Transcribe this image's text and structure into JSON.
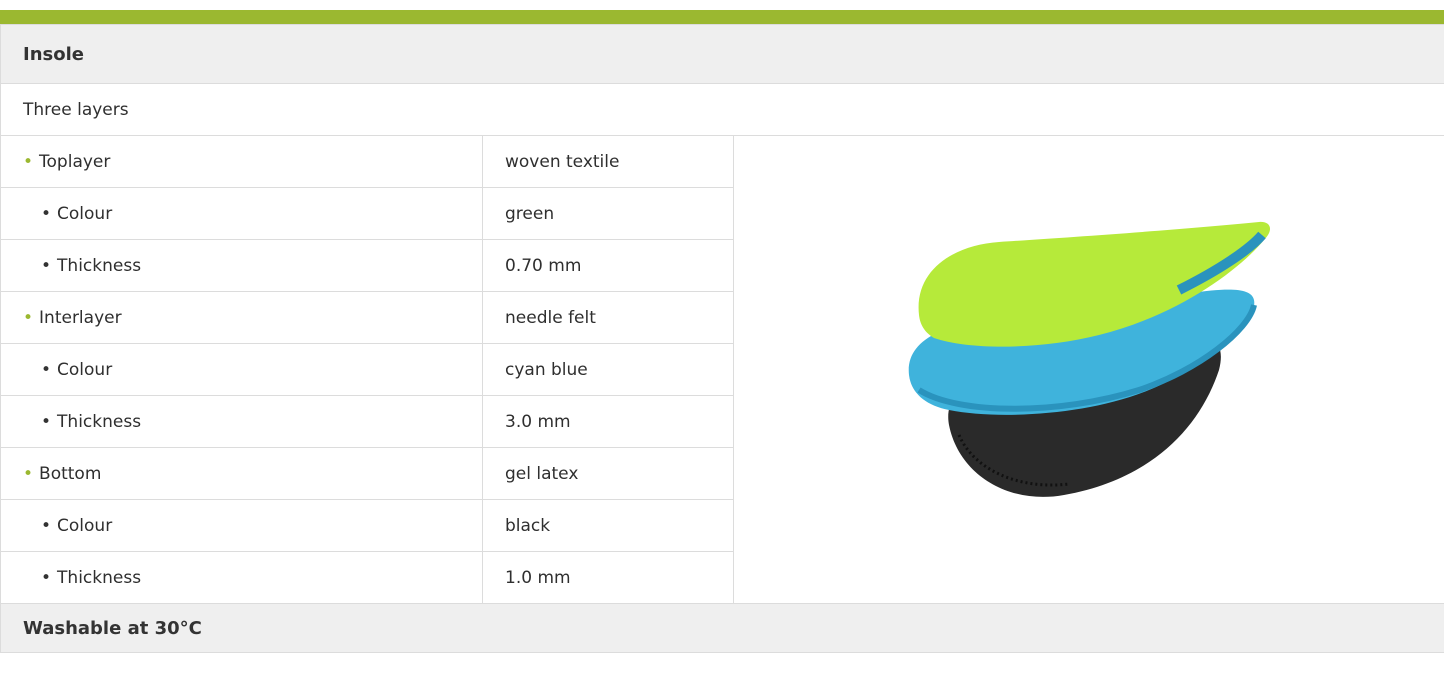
{
  "table": {
    "header": "Insole",
    "subheader": "Three layers",
    "rows": [
      {
        "label": "Toplayer",
        "value": "woven textile",
        "level": 0
      },
      {
        "label": "Colour",
        "value": "green",
        "level": 1
      },
      {
        "label": "Thickness",
        "value": "0.70 mm",
        "level": 1
      },
      {
        "label": "Interlayer",
        "value": "needle felt",
        "level": 0
      },
      {
        "label": "Colour",
        "value": "cyan blue",
        "level": 1
      },
      {
        "label": "Thickness",
        "value": "3.0 mm",
        "level": 1
      },
      {
        "label": "Bottom",
        "value": "gel latex",
        "level": 0
      },
      {
        "label": "Colour",
        "value": "black",
        "level": 1
      },
      {
        "label": "Thickness",
        "value": "1.0 mm",
        "level": 1
      }
    ],
    "footer": "Washable at 30°C"
  },
  "image": {
    "subject": "insole-layers",
    "colors": {
      "top": "#b6ea3a",
      "middle": "#3fb3dc",
      "bottom": "#2a2a2a"
    }
  },
  "accent_color": "#9bb830"
}
